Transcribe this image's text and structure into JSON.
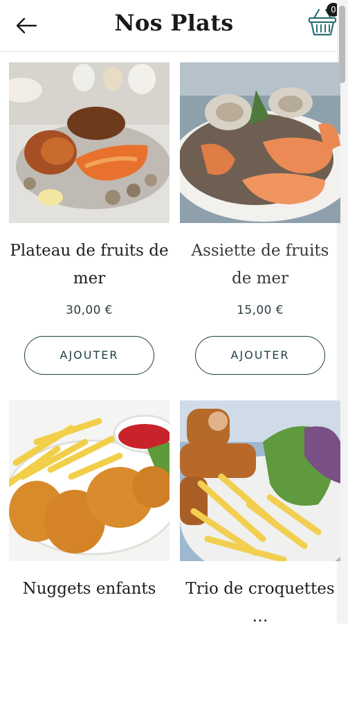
{
  "header": {
    "title": "Nos Plats",
    "back_icon": "arrow-left-icon",
    "cart_icon": "basket-icon",
    "cart_badge": "0"
  },
  "products": [
    {
      "name": "Plateau de fruits de mer",
      "price": "30,00 €",
      "button_label": "AJOUTER",
      "image": "seafood-platter-photo"
    },
    {
      "name": "Assiette de fruits de mer",
      "price": "15,00 €",
      "button_label": "AJOUTER",
      "image": "seafood-plate-photo"
    },
    {
      "name": "Nuggets enfants",
      "price": "",
      "button_label": "",
      "image": "nuggets-fries-photo"
    },
    {
      "name": "Trio de croquettes …",
      "price": "",
      "button_label": "",
      "image": "croquettes-fries-photo"
    }
  ],
  "colors": {
    "accent": "#1f3e44",
    "text": "#1e1e1e"
  }
}
